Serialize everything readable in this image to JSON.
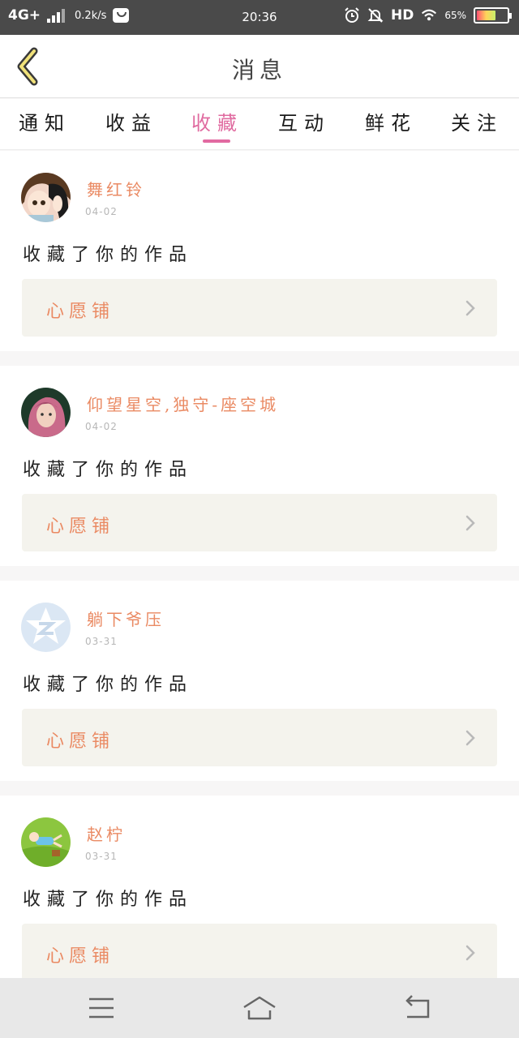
{
  "status_bar": {
    "network": "4G+",
    "speed": "0.2k/s",
    "time": "20:36",
    "hd": "HD",
    "battery_text": "65%",
    "battery_level": 0.65,
    "icons": [
      "signal-icon",
      "message-icon",
      "alarm-icon",
      "bell-off-icon",
      "wifi-icon",
      "battery-icon"
    ]
  },
  "header": {
    "title": "消息",
    "back_icon": "chevron-left-icon"
  },
  "tabs": [
    {
      "label": "通知",
      "active": false
    },
    {
      "label": "收益",
      "active": false
    },
    {
      "label": "收藏",
      "active": true
    },
    {
      "label": "互动",
      "active": false
    },
    {
      "label": "鲜花",
      "active": false
    },
    {
      "label": "关注",
      "active": false
    }
  ],
  "notifications": [
    {
      "user": "舞红铃",
      "date": "04-02",
      "action": "收藏了你的作品",
      "work": "心愿铺",
      "avatar": "anime-avatar"
    },
    {
      "user": "仰望星空,独守-座空城",
      "date": "04-02",
      "action": "收藏了你的作品",
      "work": "心愿铺",
      "avatar": "photo-avatar"
    },
    {
      "user": "躺下爷压",
      "date": "03-31",
      "action": "收藏了你的作品",
      "work": "心愿铺",
      "avatar": "default-avatar"
    },
    {
      "user": "赵柠",
      "date": "03-31",
      "action": "收藏了你的作品",
      "work": "心愿铺",
      "avatar": "grass-avatar"
    }
  ],
  "colors": {
    "accent_pink": "#e26aa1",
    "username_orange": "#ea8a63",
    "card_bg": "#f4f3ed",
    "status_bar": "#4a4a4a",
    "nav_bar": "#e8e8e8"
  },
  "nav_bar": {
    "icons": [
      "menu-icon",
      "home-icon",
      "back-icon"
    ]
  }
}
